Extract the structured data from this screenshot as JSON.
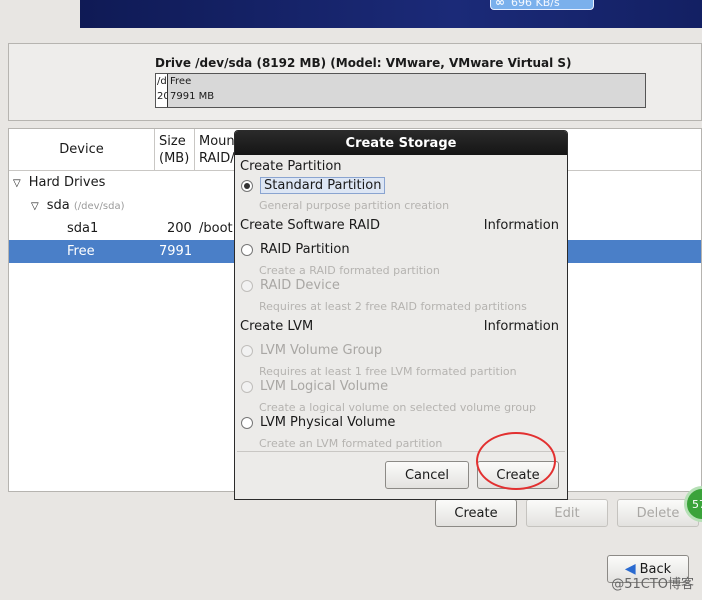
{
  "banner": {
    "speed": "696 KB/s"
  },
  "drive": {
    "title": "Drive /dev/sda (8192 MB) (Model: VMware, VMware Virtual S)",
    "seg_small_top": "/d",
    "seg_small_bottom": "20",
    "seg_free_top": "Free",
    "seg_free_bottom": "7991 MB"
  },
  "table": {
    "headers": {
      "device": "Device",
      "size_line1": "Size",
      "size_line2": "(MB)",
      "mount_line1": "Moun",
      "mount_line2": "RAID/"
    },
    "rows": [
      {
        "name": "Hard Drives",
        "size": "",
        "mount": ""
      },
      {
        "name": "sda",
        "path": "(/dev/sda)",
        "size": "",
        "mount": ""
      },
      {
        "name": "sda1",
        "size": "200",
        "mount": "/boot"
      },
      {
        "name": "Free",
        "size": "7991",
        "mount": ""
      }
    ]
  },
  "actions": {
    "create": "Create",
    "edit": "Edit",
    "delete": "Delete"
  },
  "nav": {
    "back": "Back"
  },
  "badge": "57",
  "watermark": "@51CTO博客",
  "dialog": {
    "title": "Create Storage",
    "sections": {
      "partition": "Create Partition",
      "raid": "Create Software RAID",
      "lvm": "Create LVM",
      "info": "Information"
    },
    "options": {
      "standard": {
        "label": "Standard Partition",
        "desc": "General purpose partition creation"
      },
      "raid_partition": {
        "label": "RAID Partition",
        "desc": "Create a RAID formated partition"
      },
      "raid_device": {
        "label": "RAID Device",
        "desc": "Requires at least 2 free RAID formated partitions"
      },
      "lvm_group": {
        "label": "LVM Volume Group",
        "desc": "Requires at least 1 free LVM formated partition"
      },
      "lvm_logical": {
        "label": "LVM Logical Volume",
        "desc": "Create a logical volume on selected volume group"
      },
      "lvm_physical": {
        "label": "LVM Physical Volume",
        "desc": "Create an LVM formated partition"
      }
    },
    "cancel": "Cancel",
    "create": "Create"
  }
}
